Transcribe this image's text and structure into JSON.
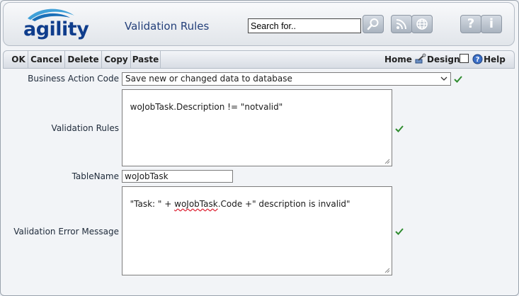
{
  "header": {
    "logo_text": "agility",
    "title": "Validation Rules",
    "search": {
      "value": "Search for.."
    },
    "buttons": [
      "search-icon",
      "rss-icon",
      "globe-icon",
      "help-icon",
      "info-icon"
    ],
    "help_glyph": "?",
    "info_glyph": "i"
  },
  "toolbar": {
    "ok": "OK",
    "cancel": "Cancel",
    "delete": "Delete",
    "copy": "Copy",
    "paste": "Paste",
    "home": "Home",
    "design": "Design",
    "help": "Help"
  },
  "form": {
    "business_action": {
      "label": "Business Action Code",
      "value": "Save new or changed data to database"
    },
    "validation_rules": {
      "label": "Validation Rules",
      "value": "woJobTask.Description != \"notvalid\""
    },
    "table_name": {
      "label": "TableName",
      "value": "woJobTask"
    },
    "error_message": {
      "label": "Validation Error Message",
      "prefix": "\"Task: \" + ",
      "misspelled": "woJobTask",
      "suffix": ".Code +\" description is invalid\""
    }
  },
  "colors": {
    "brand": "#0f3d8c",
    "title": "#24407a",
    "check": "#2e8b2e"
  }
}
